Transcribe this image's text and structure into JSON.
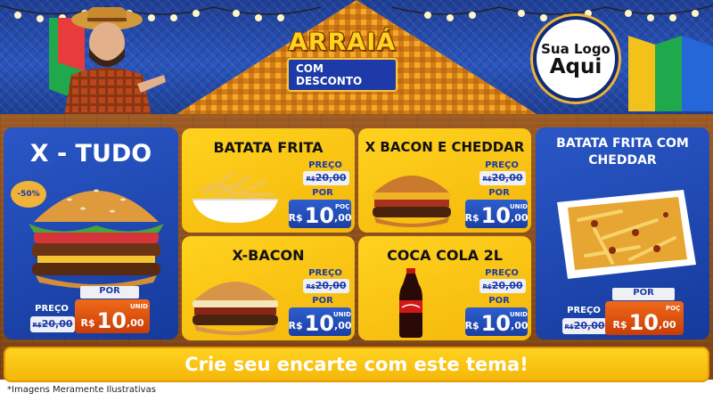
{
  "header": {
    "logo_title": "ARRAIÁ",
    "logo_subtitle": "COM DESCONTO",
    "brand_line1": "Sua Logo",
    "brand_line2": "Aqui"
  },
  "products": {
    "xtudo": {
      "title": "X - TUDO",
      "discount": "-50%",
      "old_label": "PREÇO",
      "old_currency": "R$",
      "old_value": "20,00",
      "new_label": "POR",
      "new_currency": "R$",
      "new_int": "10",
      "new_cents": ",00",
      "unit": "UNID"
    },
    "batata": {
      "title": "BATATA FRITA",
      "old_label": "PREÇO",
      "old_currency": "R$",
      "old_value": "20,00",
      "new_label": "POR",
      "new_currency": "R$",
      "new_int": "10",
      "new_cents": ",00",
      "unit": "POÇ"
    },
    "xbacon_cheddar": {
      "title": "X BACON E CHEDDAR",
      "old_label": "PREÇO",
      "old_currency": "R$",
      "old_value": "20,00",
      "new_label": "POR",
      "new_currency": "R$",
      "new_int": "10",
      "new_cents": ",00",
      "unit": "UNID"
    },
    "batata_cheddar": {
      "title_line1": "BATATA FRITA COM",
      "title_line2": "CHEDDAR",
      "old_label": "PREÇO",
      "old_currency": "R$",
      "old_value": "20,00",
      "new_label": "POR",
      "new_currency": "R$",
      "new_int": "10",
      "new_cents": ",00",
      "unit": "POÇ"
    },
    "xbacon": {
      "title": "X-BACON",
      "old_label": "PREÇO",
      "old_currency": "R$",
      "old_value": "20,00",
      "new_label": "POR",
      "new_currency": "R$",
      "new_int": "10",
      "new_cents": ",00",
      "unit": "UNID"
    },
    "coca": {
      "title": "COCA COLA 2L",
      "old_label": "PREÇO",
      "old_currency": "R$",
      "old_value": "20,00",
      "new_label": "POR",
      "new_currency": "R$",
      "new_int": "10",
      "new_cents": ",00",
      "unit": "UNID"
    }
  },
  "cta": {
    "text": "Crie seu encarte com este tema!"
  },
  "footer": {
    "text": "*Imagens Meramente Ilustrativas"
  },
  "colors": {
    "blue": "#1d3aa8",
    "yellow": "#f4b70a",
    "orange": "#e2520f",
    "wood": "#8a4c1a"
  }
}
